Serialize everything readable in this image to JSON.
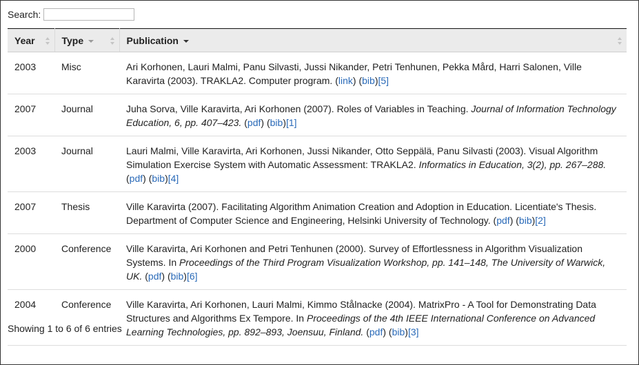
{
  "search": {
    "label": "Search:",
    "value": "",
    "placeholder": ""
  },
  "table": {
    "columns": [
      "Year",
      "Type",
      "Publication"
    ],
    "rows": [
      {
        "year": "2003",
        "type": "Misc",
        "text": "Ari Korhonen, Lauri Malmi, Panu Silvasti, Jussi Nikander, Petri Tenhunen, Pekka Mård, Harri Salonen, Ville Karavirta (2003). TRAKLA2. Computer program. ",
        "venue": "",
        "links": [
          {
            "label": "link",
            "paren": true
          },
          {
            "label": "bib",
            "paren": true
          },
          {
            "label": "[5]",
            "paren": false
          }
        ]
      },
      {
        "year": "2007",
        "type": "Journal",
        "text": "Juha Sorva, Ville Karavirta, Ari Korhonen (2007). Roles of Variables in Teaching. ",
        "venue": "Journal of Information Technology Education, 6, pp. 407–423.",
        "links": [
          {
            "label": "pdf",
            "paren": true
          },
          {
            "label": "bib",
            "paren": true
          },
          {
            "label": "[1]",
            "paren": false
          }
        ]
      },
      {
        "year": "2003",
        "type": "Journal",
        "text": "Lauri Malmi, Ville Karavirta, Ari Korhonen, Jussi Nikander, Otto Seppälä, Panu Silvasti (2003). Visual Algorithm Simulation Exercise System with Automatic Assessment: TRAKLA2. ",
        "venue": "Informatics in Education, 3(2), pp. 267–288.",
        "links": [
          {
            "label": "pdf",
            "paren": true
          },
          {
            "label": "bib",
            "paren": true
          },
          {
            "label": "[4]",
            "paren": false
          }
        ]
      },
      {
        "year": "2007",
        "type": "Thesis",
        "text": "Ville Karavirta (2007). Facilitating Algorithm Animation Creation and Adoption in Education. Licentiate's Thesis. Department of Computer Science and Engineering, Helsinki University of Technology. ",
        "venue": "",
        "links": [
          {
            "label": "pdf",
            "paren": true
          },
          {
            "label": "bib",
            "paren": true
          },
          {
            "label": "[2]",
            "paren": false
          }
        ]
      },
      {
        "year": "2000",
        "type": "Conference",
        "text": "Ville Karavirta, Ari Korhonen and Petri Tenhunen (2000). Survey of Effortlessness in Algorithm Visualization Systems. In ",
        "venue": "Proceedings of the Third Program Visualization Workshop, pp. 141–148, The University of Warwick, UK.",
        "links": [
          {
            "label": "pdf",
            "paren": true
          },
          {
            "label": "bib",
            "paren": true
          },
          {
            "label": "[6]",
            "paren": false
          }
        ]
      },
      {
        "year": "2004",
        "type": "Conference",
        "text": "Ville Karavirta, Ari Korhonen, Lauri Malmi, Kimmo Stålnacke (2004). MatrixPro - A Tool for Demonstrating Data Structures and Algorithms Ex Tempore. In ",
        "venue": "Proceedings of the 4th IEEE International Conference on Advanced Learning Technologies, pp. 892–893, Joensuu, Finland.",
        "links": [
          {
            "label": "pdf",
            "paren": true
          },
          {
            "label": "bib",
            "paren": true
          },
          {
            "label": "[3]",
            "paren": false
          }
        ]
      }
    ]
  },
  "footer": {
    "info": "Showing 1 to 6 of 6 entries"
  },
  "colors": {
    "link": "#2a6ab8",
    "header_bg": "#ebebeb",
    "row_border": "#dddddd"
  }
}
